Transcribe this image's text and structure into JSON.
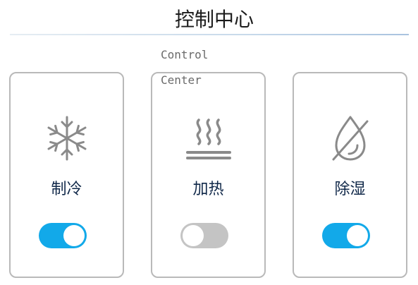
{
  "header": {
    "title": "控制中心",
    "subtitle": "Control Center"
  },
  "cards": [
    {
      "label": "制冷",
      "icon": "snowflake-icon",
      "enabled": true
    },
    {
      "label": "加热",
      "icon": "heat-icon",
      "enabled": false
    },
    {
      "label": "除湿",
      "icon": "drop-off-icon",
      "enabled": true
    }
  ],
  "colors": {
    "toggle_on": "#12a9e9",
    "toggle_off": "#c4c4c4",
    "label": "#0f2748",
    "icon": "#8a8a8a"
  }
}
